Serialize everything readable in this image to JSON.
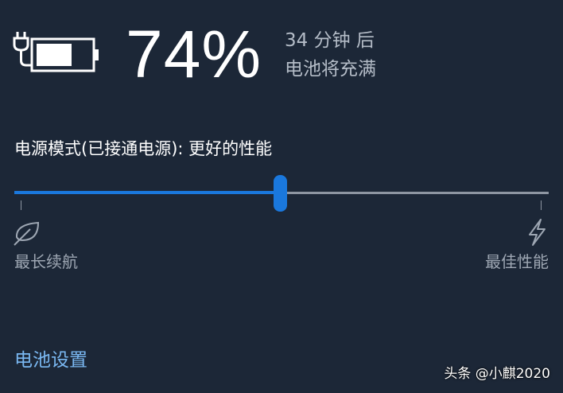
{
  "battery": {
    "icon": "battery-charging-icon",
    "percent": "74%",
    "time_left": "34 分钟 后",
    "time_status": "电池将充满"
  },
  "power_mode": {
    "label": "电源模式(已接通电源): 更好的性能",
    "slider_level_percent": 50,
    "min_label": "最长续航",
    "min_icon": "leaf-icon",
    "max_label": "最佳性能",
    "max_icon": "lightning-bolt-icon"
  },
  "settings_link": "电池设置",
  "watermark": "头条 @小麒2020",
  "colors": {
    "background": "#1c2737",
    "accent": "#1a78dd",
    "link": "#7ab8f2",
    "secondary_text": "#b4bcc7",
    "track": "#8e96a2"
  }
}
